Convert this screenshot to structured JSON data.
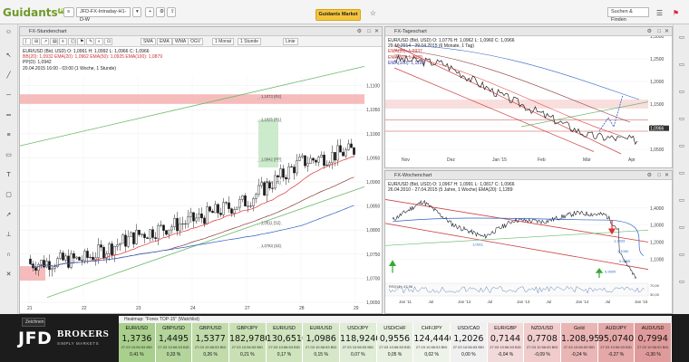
{
  "topbar": {
    "logo": "Guidants",
    "logo_badge": "PRO",
    "workspace_input": "JFD-FX-Intraday-H1-D-W",
    "buttons": [
      "",
      "",
      "",
      "",
      "",
      ""
    ],
    "orange_button": "Guidants Market",
    "search_label": "Suchen & Finden",
    "icons": [
      "star-icon",
      "menu-icon",
      "flag-icon"
    ]
  },
  "left_panel": {
    "title": "FX-Stundenchart",
    "toolbar": [
      "",
      "",
      "",
      "",
      "",
      "",
      "",
      "",
      "",
      "",
      "SMA",
      "EMA",
      "WMA",
      "OGV",
      "1 Monat",
      "1 Stunde",
      "Linie"
    ],
    "legend": [
      "EUR/USD (Bid, USD)  O: 1,0961  H: 1,0992  L: 1,0966  C: 1,0966",
      "BB(20): 1,0932    EMA(20): 1,0962    EMA(50): 1,0925    EMA(100): 1,0879",
      "PP(D): 1,0942",
      "20.04.2015 16:00 - 03:00 (1 Woche, 1 Stunde)"
    ],
    "price_axis": [
      "1,1100",
      "1,1050",
      "1,1000",
      "1,0950",
      "1,0900",
      "1,0850",
      "1,0800",
      "1,0750",
      "1,0700",
      "1,0650"
    ],
    "date_axis": [
      "21",
      "22",
      "23",
      "24",
      "27",
      "28",
      "29"
    ],
    "pivot_labels": [
      "1,1073 (R2)",
      "1,1025 (R1)",
      "1,0942 (PP)",
      "1,0894 (S1)",
      "1,0811 (S2)",
      "1,0763 (S3)"
    ]
  },
  "right_top_panel": {
    "title": "FX-Tageschart",
    "legend": [
      "EUR/USD (Bid, USD)  O: 1,0776  H: 1,0962  L: 1,0960  C: 1,0966",
      "29.10.2014 - 29.04.2015 (6 Monate, 1 Tag)",
      "EMA(20): 1,0937",
      "EMA(50): 1,0920",
      "EMA(100): 1,1199"
    ],
    "price_axis": [
      "1,3000",
      "1,2500",
      "1,2000",
      "1,1500",
      "1,1000",
      "1,0500"
    ],
    "date_axis": [
      "Nov",
      "Dez",
      "Jan '15",
      "Feb",
      "Mär",
      "Apr"
    ],
    "current_price": "1,0966"
  },
  "right_bottom_panel": {
    "title": "FX-Wochenchart",
    "legend": [
      "EUR/USD (Bid, USD)  O: 1,0967  H: 1,0991  L: 1,0817  C: 1,0966",
      "26.04.2010 - 27.04.2015 (5 Jahre, 1 Woche)    EMA(20): 1,1289"
    ],
    "price_axis": [
      "1,4000",
      "1,3000",
      "1,2000",
      "1,1000"
    ],
    "date_axis": [
      "Jan '11",
      "Jul",
      "Jan '12",
      "Jul",
      "Jan '13",
      "Jul",
      "Jan '14",
      "Jul",
      "Jan '15"
    ],
    "level_labels": [
      "1,0911",
      "1,1433",
      "1,1050",
      "0,9935",
      "0,9900"
    ],
    "indicator_label": "RSI(14): 47,96",
    "indicator_values": [
      "70,00",
      "30,00"
    ]
  },
  "heatmap": {
    "header": "Heatmap: \"Forex TOP-15\" (Watchlist)",
    "cells": [
      {
        "sym": "EUR/USD",
        "val": "1,3736",
        "dt": "27.03 10:56:53 BID",
        "chg": "0,41 %",
        "color": "#a9cf8d"
      },
      {
        "sym": "GBP/USD",
        "val": "1,4495",
        "dt": "27.03 10:56:53 BID",
        "chg": "0,33 %",
        "color": "#b3d49a"
      },
      {
        "sym": "GBP/USD",
        "val": "1,5377",
        "dt": "27.03 10:56:53 BID",
        "chg": "0,26 %",
        "color": "#c1dbab"
      },
      {
        "sym": "GBP/JPY",
        "val": "182,9780",
        "dt": "27.03 10:56:53 BID",
        "chg": "0,21 %",
        "color": "#c9e0b5"
      },
      {
        "sym": "EUR/USD",
        "val": "130,6510",
        "dt": "27.03 10:56:53 BID",
        "chg": "0,17 %",
        "color": "#cfe3bd"
      },
      {
        "sym": "EUR/USD",
        "val": "1,0986",
        "dt": "27.03 10:56:53 BID",
        "chg": "0,15 %",
        "color": "#d6e7c8"
      },
      {
        "sym": "USD/JPY",
        "val": "118,9240",
        "dt": "27.03 10:56:53 BID",
        "chg": "0,07 %",
        "color": "#e0ecd6"
      },
      {
        "sym": "USD/CHF",
        "val": "0,9556",
        "dt": "27.03 10:56:53 BID",
        "chg": "0,05 %",
        "color": "#e8f0e1"
      },
      {
        "sym": "CHF/JPY",
        "val": "124,4440",
        "dt": "27.03 10:56:53 BID",
        "chg": "0,02 %",
        "color": "#eef3ea"
      },
      {
        "sym": "USD/CAD",
        "val": "1,2026",
        "dt": "27.03 10:56:53 BID",
        "chg": "0,00 %",
        "color": "#f0f0f0"
      },
      {
        "sym": "EUR/GBP",
        "val": "0,7144",
        "dt": "27.03 10:56:53 BID",
        "chg": "-0,04 %",
        "color": "#f3dada"
      },
      {
        "sym": "NZD/USD",
        "val": "0,7708",
        "dt": "27.03 10:56:53 BID",
        "chg": "-0,09 %",
        "color": "#f0cccc"
      },
      {
        "sym": "Gold",
        "val": "1.208,95",
        "dt": "27.03 10:56:53 BID",
        "chg": "-0,24 %",
        "color": "#e9b5b5"
      },
      {
        "sym": "AUD/JPY",
        "val": "95,0740",
        "dt": "27.03 10:56:53 BID",
        "chg": "-0,27 %",
        "color": "#e4a8a8"
      },
      {
        "sym": "AUD/USD",
        "val": "0,7994",
        "dt": "27.03 10:56:53 BID",
        "chg": "-0,30 %",
        "color": "#df9b9b"
      }
    ]
  },
  "bottom": {
    "tab_label": "Zeichnen",
    "brand": "JFD",
    "brand_suffix": "BROKERS",
    "tagline": "SIMPLY MARKETS"
  },
  "chart_data": [
    {
      "type": "candlestick",
      "title": "EUR/USD (Bid, USD)",
      "timeframe": "1 Stunde",
      "x": [
        "21",
        "22",
        "23",
        "24",
        "27",
        "28",
        "29"
      ],
      "ylim": [
        1.065,
        1.112
      ],
      "close_approx": [
        1.073,
        1.074,
        1.079,
        1.082,
        1.086,
        1.094,
        1.0966
      ],
      "pivot_levels": [
        1.1073,
        1.1025,
        1.0942,
        1.0894,
        1.0811,
        1.0763
      ]
    },
    {
      "type": "line",
      "title": "EUR/USD (Bid, USD)",
      "timeframe": "1 Tag",
      "x": [
        "Nov",
        "Dez",
        "Jan '15",
        "Feb",
        "Mär",
        "Apr"
      ],
      "ylim": [
        1.04,
        1.3
      ],
      "values_approx": [
        1.25,
        1.24,
        1.18,
        1.13,
        1.08,
        1.07
      ]
    },
    {
      "type": "line",
      "title": "EUR/USD (Bid, USD)",
      "timeframe": "1 Woche",
      "x": [
        "Jan '11",
        "Jul",
        "Jan '12",
        "Jul",
        "Jan '13",
        "Jul",
        "Jan '14",
        "Jul",
        "Jan '15"
      ],
      "ylim": [
        0.98,
        1.5
      ],
      "values_approx": [
        1.33,
        1.44,
        1.3,
        1.23,
        1.33,
        1.32,
        1.37,
        1.36,
        1.14
      ]
    }
  ]
}
